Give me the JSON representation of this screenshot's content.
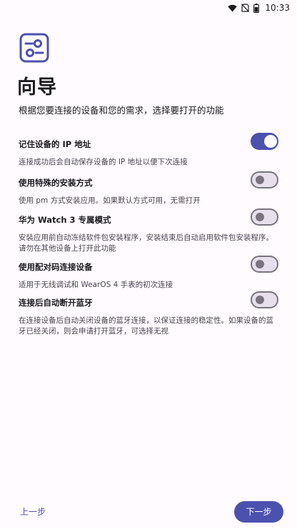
{
  "status_bar": {
    "time": "10:33",
    "icons": [
      "wifi-icon",
      "no-sim-icon",
      "battery-icon"
    ]
  },
  "hero": {
    "icon": "settings-sliders-icon"
  },
  "header": {
    "title": "向导",
    "subtitle": "根据您要连接的设备和您的需求，选择要打开的功能"
  },
  "settings": [
    {
      "title": "记住设备的 IP 地址",
      "description": "连接成功后会自动保存设备的 IP 地址以便下次连接",
      "enabled": true
    },
    {
      "title": "使用特殊的安装方式",
      "description": "使用 pm 方式安装应用。如果默认方式可用，无需打开",
      "enabled": false
    },
    {
      "title": "华为 Watch 3 专属模式",
      "description": "安装应用前自动冻结软件包安装程序，安装结束后自动启用软件包安装程序。请勿在其他设备上打开此功能",
      "enabled": false
    },
    {
      "title": "使用配对码连接设备",
      "description": "适用于无线调试和 WearOS 4 手表的初次连接",
      "enabled": false
    },
    {
      "title": "连接后自动断开蓝牙",
      "description": "在连接设备后自动关闭设备的蓝牙连接，以保证连接的稳定性。如果设备的蓝牙已经关闭，则会申请打开蓝牙，可选择无视",
      "enabled": false
    }
  ],
  "footer": {
    "back_label": "上一步",
    "next_label": "下一步"
  },
  "colors": {
    "accent": "#4c51b0",
    "background": "#fffbff",
    "switch_off_track": "#e7e0ec",
    "switch_off_outline": "#79747e"
  }
}
